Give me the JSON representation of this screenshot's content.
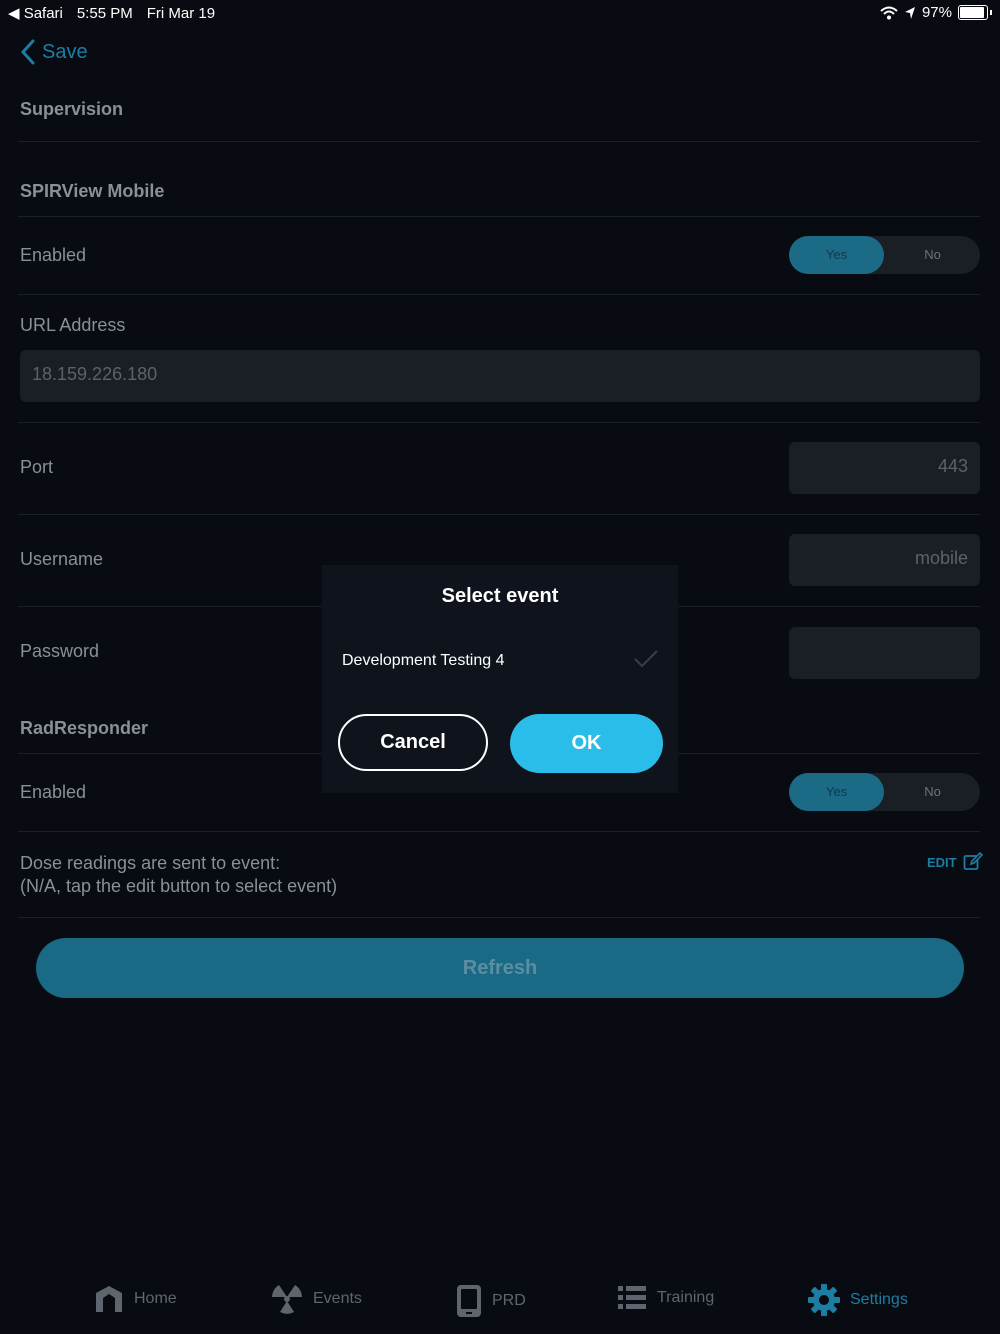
{
  "status_bar": {
    "back_app": "Safari",
    "time": "5:55 PM",
    "date": "Fri Mar 19",
    "battery": "97%"
  },
  "nav": {
    "back_label": "Save"
  },
  "sections": {
    "supervision": "Supervision",
    "spirview": "SPIRView Mobile",
    "radresponder": "RadResponder"
  },
  "spirview": {
    "enabled_label": "Enabled",
    "toggle_yes": "Yes",
    "toggle_no": "No",
    "url_label": "URL Address",
    "url_value": "18.159.226.180",
    "port_label": "Port",
    "port_value": "443",
    "username_label": "Username",
    "username_value": "mobile",
    "password_label": "Password",
    "password_value": ""
  },
  "radresponder": {
    "enabled_label": "Enabled",
    "toggle_yes": "Yes",
    "toggle_no": "No",
    "dose_line1": "Dose readings are sent to event:",
    "dose_line2": "(N/A, tap the edit button to select event)",
    "edit_label": "EDIT"
  },
  "refresh_label": "Refresh",
  "dialog": {
    "title": "Select event",
    "item": "Development Testing 4",
    "cancel": "Cancel",
    "ok": "OK"
  },
  "tabs": [
    {
      "label": "Home",
      "icon": "home-icon"
    },
    {
      "label": "Events",
      "icon": "radiation-icon"
    },
    {
      "label": "PRD",
      "icon": "device-icon"
    },
    {
      "label": "Training",
      "icon": "list-icon"
    },
    {
      "label": "Settings",
      "icon": "gear-icon"
    }
  ],
  "colors": {
    "background": "#080b11",
    "accent": "#1d7ea3",
    "ok_button": "#2bbde9"
  }
}
